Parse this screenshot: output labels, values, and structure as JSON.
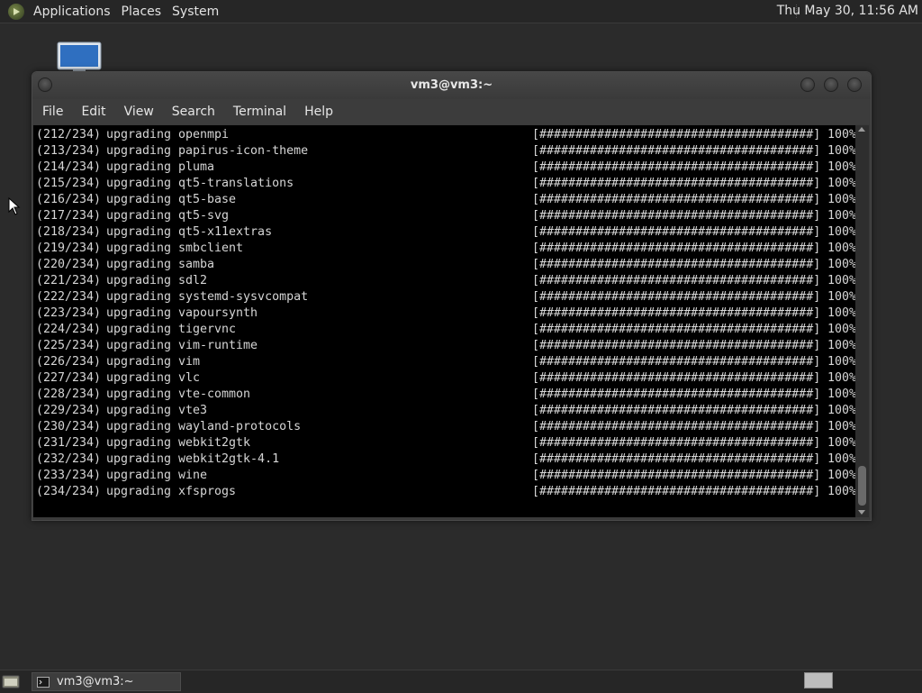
{
  "top_panel": {
    "menus": [
      "Applications",
      "Places",
      "System"
    ],
    "clock": "Thu May 30, 11:56 AM"
  },
  "window": {
    "title": "vm3@vm3:~",
    "menu": [
      "File",
      "Edit",
      "View",
      "Search",
      "Terminal",
      "Help"
    ]
  },
  "terminal": {
    "progress_bar": "[######################################]",
    "lines": [
      {
        "index": "(212/234)",
        "action": "upgrading",
        "package": "openmpi",
        "percent": "100%"
      },
      {
        "index": "(213/234)",
        "action": "upgrading",
        "package": "papirus-icon-theme",
        "percent": "100%"
      },
      {
        "index": "(214/234)",
        "action": "upgrading",
        "package": "pluma",
        "percent": "100%"
      },
      {
        "index": "(215/234)",
        "action": "upgrading",
        "package": "qt5-translations",
        "percent": "100%"
      },
      {
        "index": "(216/234)",
        "action": "upgrading",
        "package": "qt5-base",
        "percent": "100%"
      },
      {
        "index": "(217/234)",
        "action": "upgrading",
        "package": "qt5-svg",
        "percent": "100%"
      },
      {
        "index": "(218/234)",
        "action": "upgrading",
        "package": "qt5-x11extras",
        "percent": "100%"
      },
      {
        "index": "(219/234)",
        "action": "upgrading",
        "package": "smbclient",
        "percent": "100%"
      },
      {
        "index": "(220/234)",
        "action": "upgrading",
        "package": "samba",
        "percent": "100%"
      },
      {
        "index": "(221/234)",
        "action": "upgrading",
        "package": "sdl2",
        "percent": "100%"
      },
      {
        "index": "(222/234)",
        "action": "upgrading",
        "package": "systemd-sysvcompat",
        "percent": "100%"
      },
      {
        "index": "(223/234)",
        "action": "upgrading",
        "package": "vapoursynth",
        "percent": "100%"
      },
      {
        "index": "(224/234)",
        "action": "upgrading",
        "package": "tigervnc",
        "percent": "100%"
      },
      {
        "index": "(225/234)",
        "action": "upgrading",
        "package": "vim-runtime",
        "percent": "100%"
      },
      {
        "index": "(226/234)",
        "action": "upgrading",
        "package": "vim",
        "percent": "100%"
      },
      {
        "index": "(227/234)",
        "action": "upgrading",
        "package": "vlc",
        "percent": "100%"
      },
      {
        "index": "(228/234)",
        "action": "upgrading",
        "package": "vte-common",
        "percent": "100%"
      },
      {
        "index": "(229/234)",
        "action": "upgrading",
        "package": "vte3",
        "percent": "100%"
      },
      {
        "index": "(230/234)",
        "action": "upgrading",
        "package": "wayland-protocols",
        "percent": "100%"
      },
      {
        "index": "(231/234)",
        "action": "upgrading",
        "package": "webkit2gtk",
        "percent": "100%"
      },
      {
        "index": "(232/234)",
        "action": "upgrading",
        "package": "webkit2gtk-4.1",
        "percent": "100%"
      },
      {
        "index": "(233/234)",
        "action": "upgrading",
        "package": "wine",
        "percent": "100%"
      },
      {
        "index": "(234/234)",
        "action": "upgrading",
        "package": "xfsprogs",
        "percent": "100%"
      }
    ]
  },
  "bottom_panel": {
    "task_label": "vm3@vm3:~"
  },
  "colors": {
    "panel_bg": "#262626",
    "desktop_bg": "#2b2b2b",
    "terminal_bg": "#000000",
    "terminal_fg": "#d6d6d6"
  },
  "icons": {
    "apps_menu": "mate-logo-icon",
    "desktop": "computer-icon",
    "task": "terminal-icon",
    "show_desktop": "show-desktop-icon"
  }
}
